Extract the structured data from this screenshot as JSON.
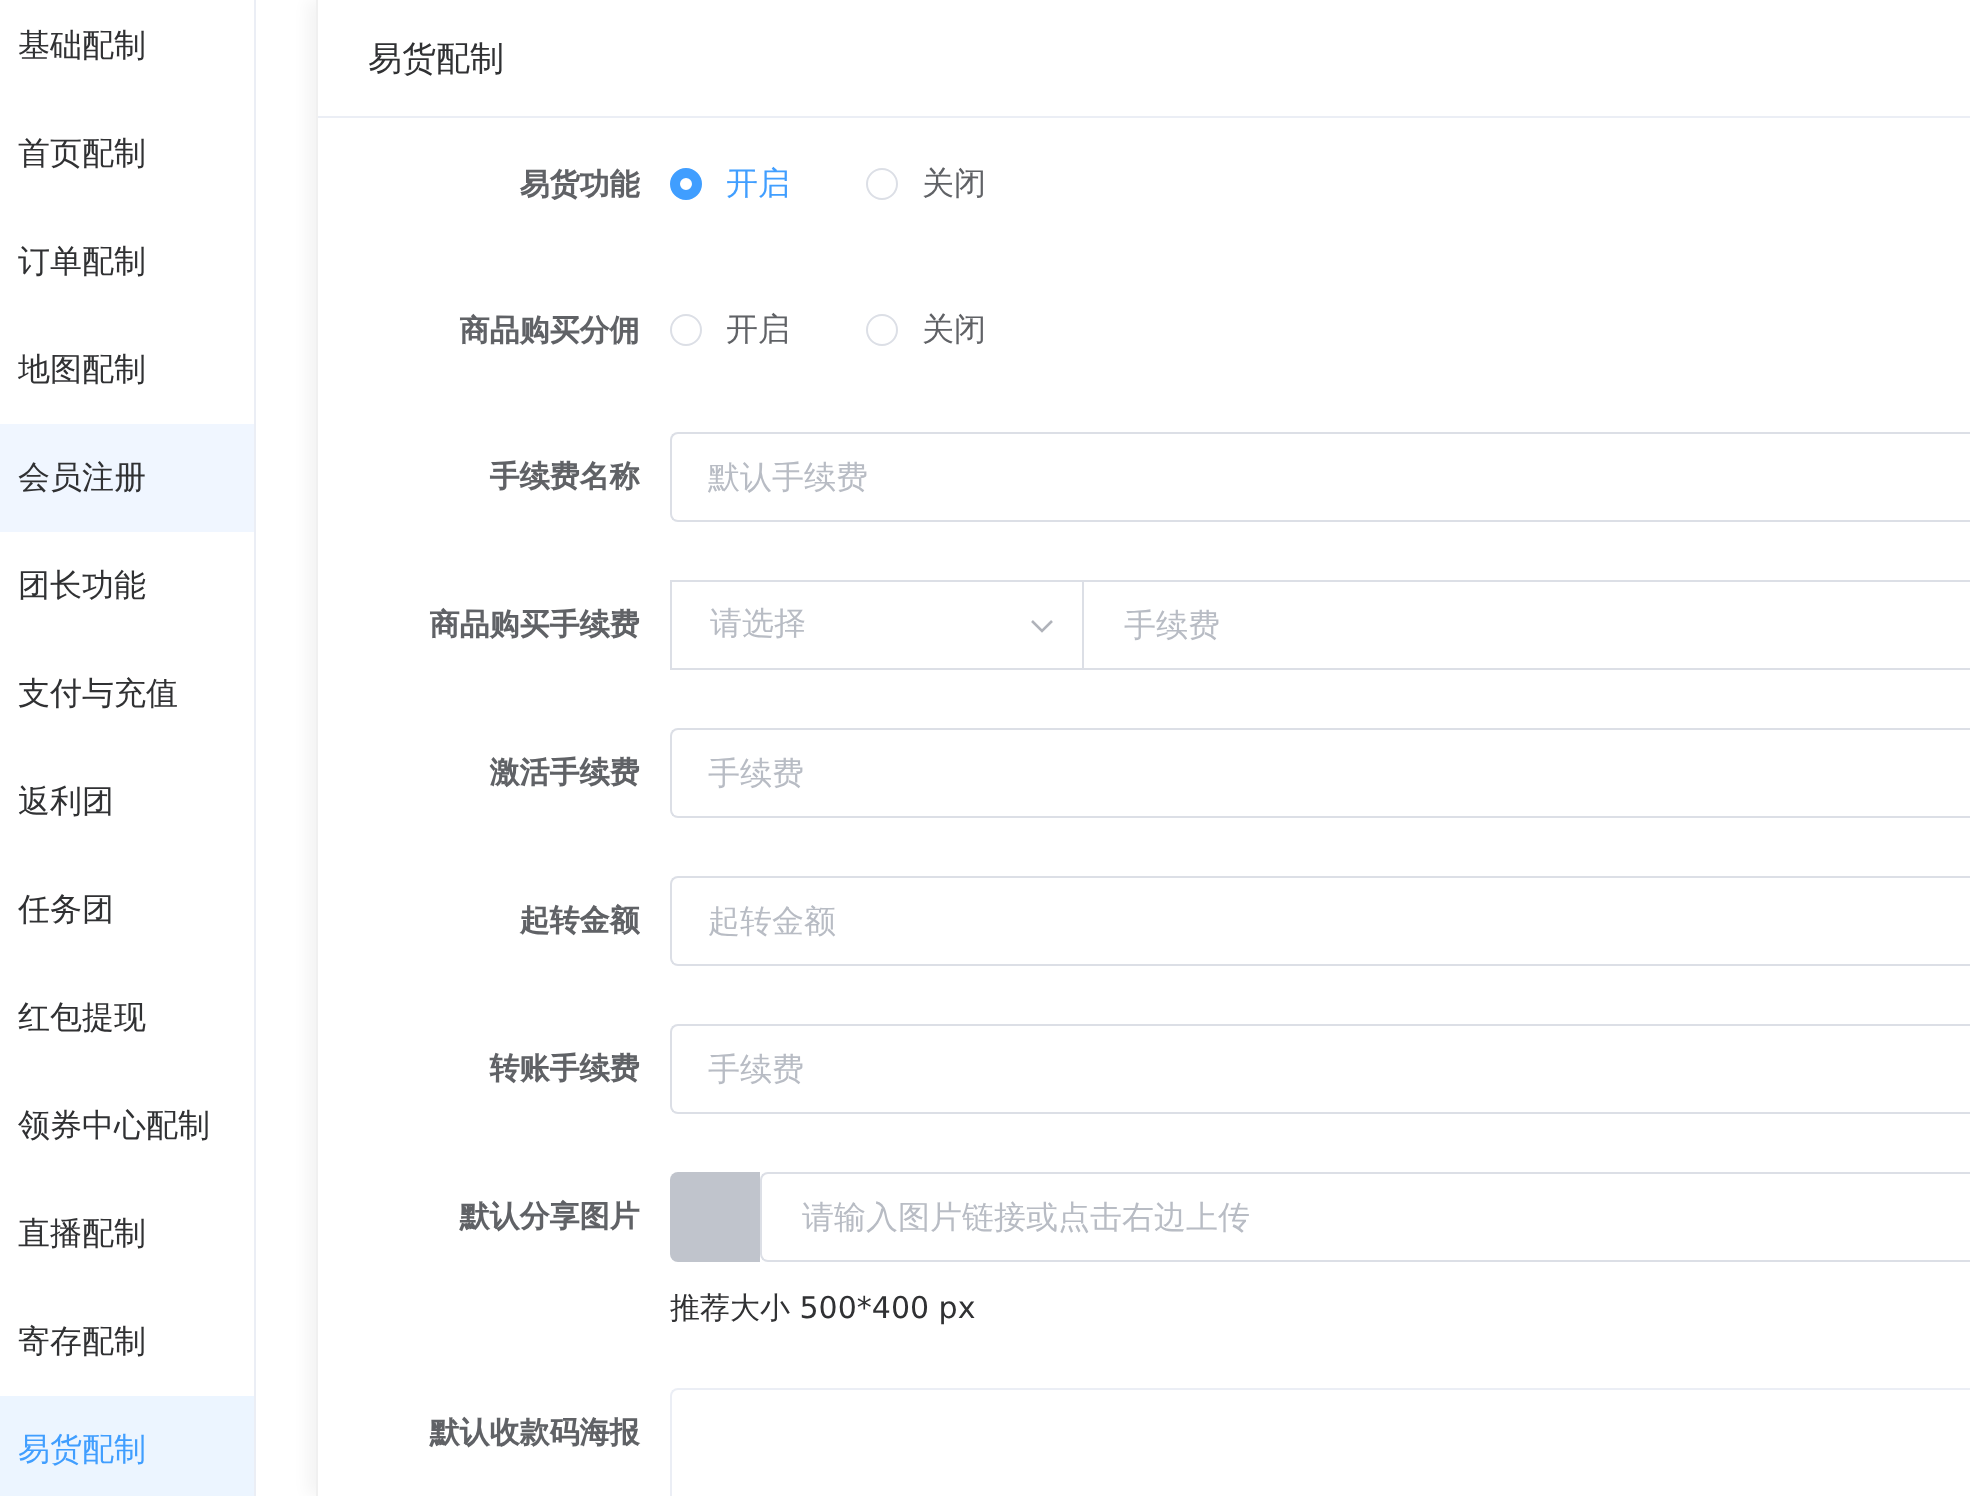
{
  "sidebar": {
    "items": [
      {
        "label": "基础配制",
        "selected": false,
        "hovered": false
      },
      {
        "label": "首页配制",
        "selected": false,
        "hovered": false
      },
      {
        "label": "订单配制",
        "selected": false,
        "hovered": false
      },
      {
        "label": "地图配制",
        "selected": false,
        "hovered": false
      },
      {
        "label": "会员注册",
        "selected": false,
        "hovered": true
      },
      {
        "label": "团长功能",
        "selected": false,
        "hovered": false
      },
      {
        "label": "支付与充值",
        "selected": false,
        "hovered": false
      },
      {
        "label": "返利团",
        "selected": false,
        "hovered": false
      },
      {
        "label": "任务团",
        "selected": false,
        "hovered": false
      },
      {
        "label": "红包提现",
        "selected": false,
        "hovered": false
      },
      {
        "label": "领券中心配制",
        "selected": false,
        "hovered": false
      },
      {
        "label": "直播配制",
        "selected": false,
        "hovered": false
      },
      {
        "label": "寄存配制",
        "selected": false,
        "hovered": false
      },
      {
        "label": "易货配制",
        "selected": true,
        "hovered": false
      }
    ]
  },
  "card": {
    "title": "易货配制",
    "fields": [
      {
        "kind": "radio",
        "label": "易货功能",
        "options": [
          {
            "label": "开启",
            "selected": true
          },
          {
            "label": "关闭",
            "selected": false
          }
        ]
      },
      {
        "kind": "radio",
        "label": "商品购买分佣",
        "options": [
          {
            "label": "开启",
            "selected": false
          },
          {
            "label": "关闭",
            "selected": false
          }
        ]
      },
      {
        "kind": "input",
        "label": "手续费名称",
        "placeholder": "默认手续费"
      },
      {
        "kind": "select_input",
        "label": "商品购买手续费",
        "select_placeholder": "请选择",
        "placeholder": "手续费"
      },
      {
        "kind": "input",
        "label": "激活手续费",
        "placeholder": "手续费"
      },
      {
        "kind": "input",
        "label": "起转金额",
        "placeholder": "起转金额"
      },
      {
        "kind": "input",
        "label": "转账手续费",
        "placeholder": "手续费"
      },
      {
        "kind": "image_input",
        "label": "默认分享图片",
        "placeholder": "请输入图片链接或点击右边上传",
        "hint": "推荐大小 500*400 px"
      },
      {
        "kind": "upload",
        "label": "默认收款码海报"
      }
    ]
  }
}
